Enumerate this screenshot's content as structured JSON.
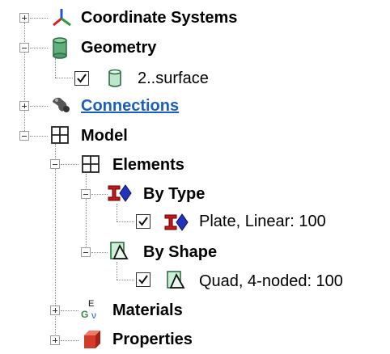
{
  "tree": {
    "coordinate_systems": {
      "label": "Coordinate Systems",
      "icon": "axes-icon"
    },
    "geometry": {
      "label": "Geometry",
      "icon": "cylinder-icon"
    },
    "geometry_surface": {
      "label": "2..surface",
      "checked": true,
      "icon": "surface-icon"
    },
    "connections": {
      "label": "Connections",
      "icon": "connection-icon"
    },
    "model": {
      "label": "Model",
      "icon": "grid-icon"
    },
    "elements": {
      "label": "Elements",
      "icon": "grid-icon"
    },
    "by_type": {
      "label": "By Type",
      "icon": "element-type-icon"
    },
    "by_type_item": {
      "label": "Plate, Linear: 100",
      "checked": true,
      "icon": "element-type-icon"
    },
    "by_shape": {
      "label": "By Shape",
      "icon": "shape-icon"
    },
    "by_shape_item": {
      "label": "Quad, 4-noded: 100",
      "checked": true,
      "icon": "shape-icon"
    },
    "materials": {
      "label": "Materials",
      "icon": "materials-icon"
    },
    "properties": {
      "label": "Properties",
      "icon": "properties-icon"
    }
  },
  "colors": {
    "link": "#1a5fc0",
    "geometry_green": "#4f9a6a",
    "element_red": "#c21a1a",
    "element_blue": "#2233bb",
    "shape_green": "#3e8a4e"
  }
}
